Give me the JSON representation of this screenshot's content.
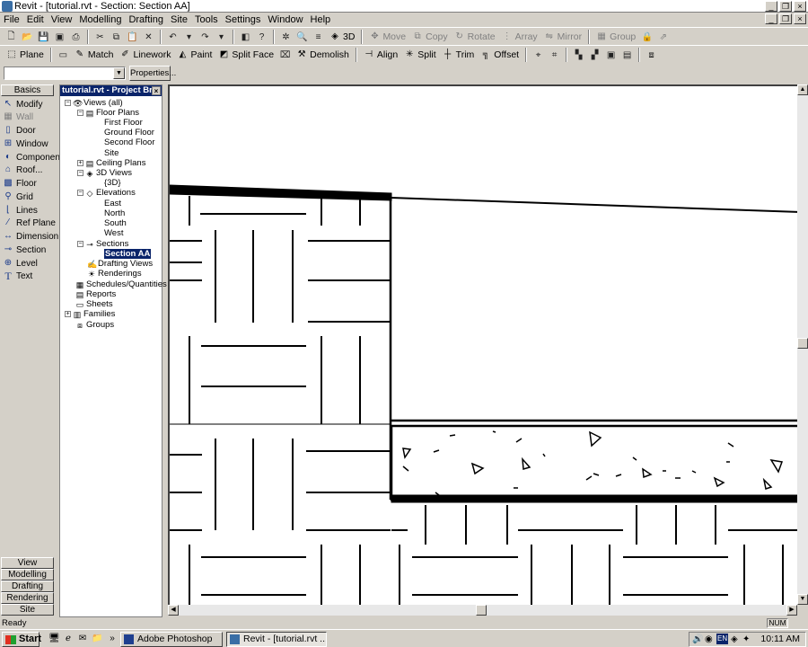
{
  "window": {
    "title": "Revit - [tutorial.rvt - Section: Section AA]"
  },
  "menu": [
    "File",
    "Edit",
    "View",
    "Modelling",
    "Drafting",
    "Site",
    "Tools",
    "Settings",
    "Window",
    "Help"
  ],
  "toolbar1": {
    "view3d_label": "3D",
    "move_label": "Move",
    "copy_label": "Copy",
    "rotate_label": "Rotate",
    "array_label": "Array",
    "mirror_label": "Mirror",
    "group_label": "Group"
  },
  "toolbar2": {
    "plane": "Plane",
    "match": "Match",
    "linework": "Linework",
    "paint": "Paint",
    "splitface": "Split Face",
    "demolish": "Demolish",
    "align": "Align",
    "split": "Split",
    "trim": "Trim",
    "offset": "Offset"
  },
  "options": {
    "type_value": "",
    "properties_label": "Properties..."
  },
  "design_bar": {
    "active_tab": "Basics",
    "tools": [
      "Modify",
      "Wall",
      "Door",
      "Window",
      "Component",
      "Roof...",
      "Floor",
      "Grid",
      "Lines",
      "Ref Plane",
      "Dimension",
      "Section",
      "Level",
      "Text"
    ],
    "bottom_tabs": [
      "View",
      "Modelling",
      "Drafting",
      "Rendering",
      "Site"
    ]
  },
  "project_browser": {
    "title": "tutorial.rvt - Project Br",
    "nodes": [
      {
        "label": "Views (all)"
      },
      {
        "label": "Floor Plans"
      },
      {
        "label": "First Floor"
      },
      {
        "label": "Ground Floor"
      },
      {
        "label": "Second Floor"
      },
      {
        "label": "Site"
      },
      {
        "label": "Ceiling Plans"
      },
      {
        "label": "3D Views"
      },
      {
        "label": "{3D}"
      },
      {
        "label": "Elevations"
      },
      {
        "label": "East"
      },
      {
        "label": "North"
      },
      {
        "label": "South"
      },
      {
        "label": "West"
      },
      {
        "label": "Sections"
      },
      {
        "label": "Section AA"
      },
      {
        "label": "Drafting Views"
      },
      {
        "label": "Renderings"
      },
      {
        "label": "Schedules/Quantities"
      },
      {
        "label": "Reports"
      },
      {
        "label": "Sheets"
      },
      {
        "label": "Families"
      },
      {
        "label": "Groups"
      }
    ]
  },
  "status": {
    "text": "Ready",
    "num": "NUM"
  },
  "taskbar": {
    "start": "Start",
    "tasks": [
      "Adobe Photoshop",
      "Revit - [tutorial.rvt ..."
    ],
    "lang": "EN",
    "time": "10:11 AM"
  }
}
